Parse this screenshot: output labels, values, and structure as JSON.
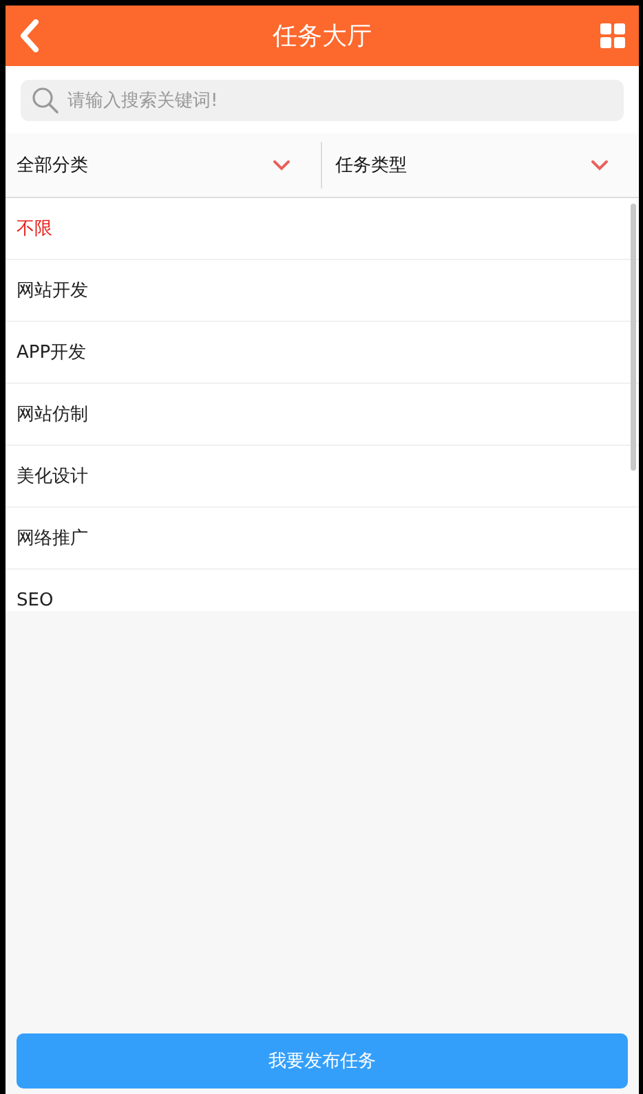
{
  "header": {
    "title": "任务大厅"
  },
  "search": {
    "placeholder": "请输入搜索关键词!"
  },
  "filters": [
    {
      "label": "全部分类"
    },
    {
      "label": "任务类型"
    }
  ],
  "options": [
    {
      "label": "不限",
      "selected": true
    },
    {
      "label": "网站开发",
      "selected": false
    },
    {
      "label": "APP开发",
      "selected": false
    },
    {
      "label": "网站仿制",
      "selected": false
    },
    {
      "label": "美化设计",
      "selected": false
    },
    {
      "label": "网络推广",
      "selected": false
    },
    {
      "label": "SEO",
      "selected": false
    }
  ],
  "publish_button": "我要发布任务"
}
